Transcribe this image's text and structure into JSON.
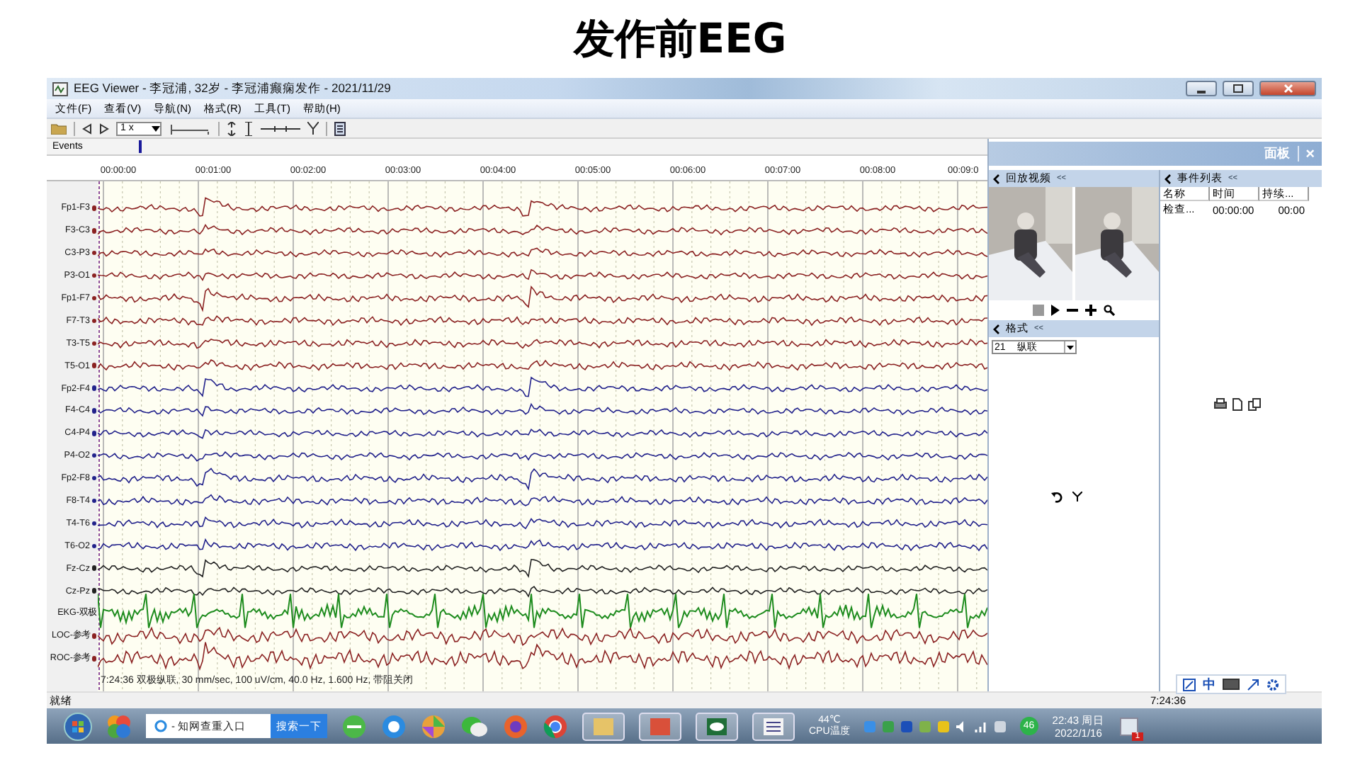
{
  "slide_title": "发作前EEG",
  "window": {
    "title": "EEG Viewer - 李冠浦, 32岁 - 李冠浦癫痫发作 - 2021/11/29"
  },
  "menu": [
    "文件(F)",
    "查看(V)",
    "导航(N)",
    "格式(R)",
    "工具(T)",
    "帮助(H)"
  ],
  "toolbar": {
    "speed": "1 x"
  },
  "events_label": "Events",
  "ruler": [
    "00:00:00",
    "00:01:00",
    "00:02:00",
    "00:03:00",
    "00:04:00",
    "00:05:00",
    "00:06:00",
    "00:07:00",
    "00:08:00",
    "00:09:0"
  ],
  "channels": [
    {
      "label": "Fp1-F3",
      "color": "#8b2222",
      "kind": "eeg"
    },
    {
      "label": "F3-C3",
      "color": "#8b2222",
      "kind": "eeg"
    },
    {
      "label": "C3-P3",
      "color": "#8b2222",
      "kind": "eeg"
    },
    {
      "label": "P3-O1",
      "color": "#8b2222",
      "kind": "eeg"
    },
    {
      "label": "Fp1-F7",
      "color": "#8b2222",
      "kind": "eeg"
    },
    {
      "label": "F7-T3",
      "color": "#8b2222",
      "kind": "eeg"
    },
    {
      "label": "T3-T5",
      "color": "#8b2222",
      "kind": "eeg"
    },
    {
      "label": "T5-O1",
      "color": "#8b2222",
      "kind": "eeg"
    },
    {
      "label": "Fp2-F4",
      "color": "#22228b",
      "kind": "eeg"
    },
    {
      "label": "F4-C4",
      "color": "#22228b",
      "kind": "eeg"
    },
    {
      "label": "C4-P4",
      "color": "#22228b",
      "kind": "eeg"
    },
    {
      "label": "P4-O2",
      "color": "#22228b",
      "kind": "eeg"
    },
    {
      "label": "Fp2-F8",
      "color": "#22228b",
      "kind": "eeg"
    },
    {
      "label": "F8-T4",
      "color": "#22228b",
      "kind": "eeg"
    },
    {
      "label": "T4-T6",
      "color": "#22228b",
      "kind": "eeg"
    },
    {
      "label": "T6-O2",
      "color": "#22228b",
      "kind": "eeg"
    },
    {
      "label": "Fz-Cz",
      "color": "#222222",
      "kind": "eeg"
    },
    {
      "label": "Cz-Pz",
      "color": "#222222",
      "kind": "eeg"
    },
    {
      "label": "EKG-双极",
      "color": "#1e8c1e",
      "kind": "ekg"
    },
    {
      "label": "LOC-参考",
      "color": "#8b2222",
      "kind": "eeg"
    },
    {
      "label": "ROC-参考",
      "color": "#8b2222",
      "kind": "eeg"
    }
  ],
  "info_line": "7:24:36 双极纵联, 30 mm/sec, 100 uV/cm, 40.0 Hz, 1.600 Hz, 带阻关闭",
  "panel": {
    "title": "面板",
    "close": "×",
    "video_section": {
      "title": "回放视频",
      "collapse": "<<"
    },
    "format_section": {
      "title": "格式",
      "collapse": "<<",
      "montage_number": "21",
      "montage": "纵联"
    },
    "event_section": {
      "title": "事件列表",
      "collapse": "<<",
      "columns": [
        "名称",
        "时间",
        "持续..."
      ],
      "rows": [
        [
          "检查...",
          "00:00:00",
          "00:00"
        ]
      ]
    }
  },
  "status_bar": {
    "text": "就绪",
    "time": "7:24:36"
  },
  "ime_bar": {
    "label": "中"
  },
  "taskbar": {
    "search_text": "- 知网查重入口",
    "search_button": "搜索一下",
    "temperature": "44℃",
    "temperature_label": "CPU温度",
    "badge": "46",
    "time": "22:43 周日",
    "date": "2022/1/16",
    "notification_count": "1"
  }
}
